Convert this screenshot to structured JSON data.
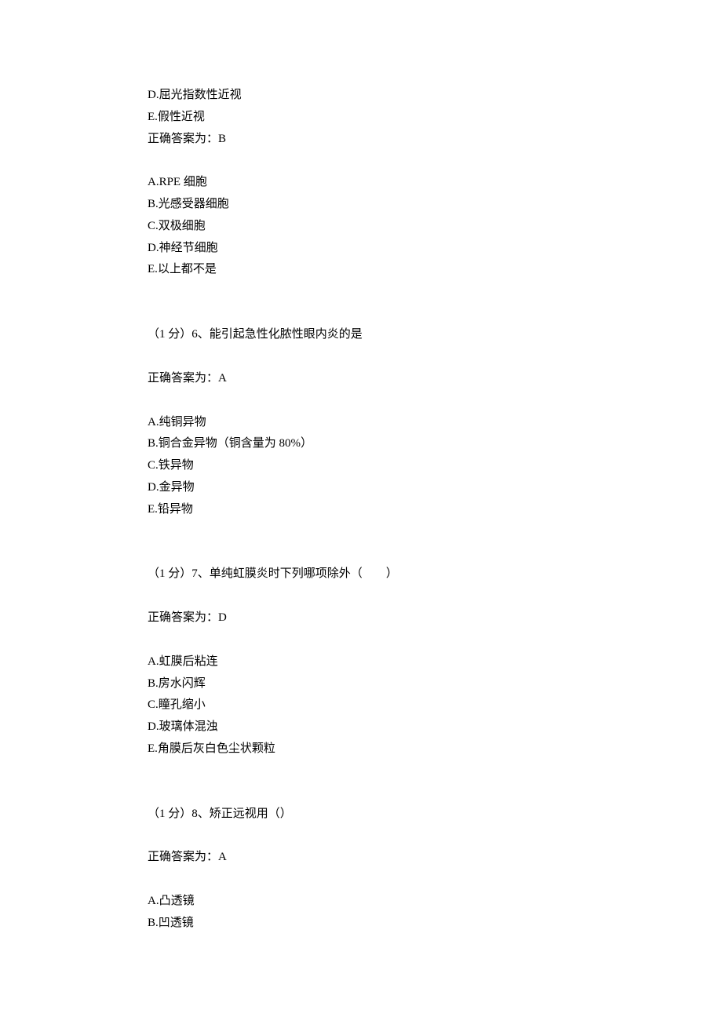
{
  "block1": {
    "lines": [
      "D.屈光指数性近视",
      "E.假性近视",
      "正确答案为：B"
    ]
  },
  "block2": {
    "lines": [
      "A.RPE 细胞",
      "B.光感受器细胞",
      "C.双极细胞",
      "D.神经节细胞",
      "E.以上都不是"
    ]
  },
  "q6": {
    "question": "（1 分）6、能引起急性化脓性眼内炎的是",
    "answer": "正确答案为：A",
    "options": [
      "A.纯铜异物",
      "B.铜合金异物（铜含量为 80%）",
      "C.铁异物",
      "D.金异物",
      "E.铅异物"
    ]
  },
  "q7": {
    "question": "（1 分）7、单纯虹膜炎时下列哪项除外（　　）",
    "answer": "正确答案为：D",
    "options": [
      "A.虹膜后粘连",
      "B.房水闪辉",
      "C.瞳孔缩小",
      "D.玻璃体混浊",
      "E.角膜后灰白色尘状颗粒"
    ]
  },
  "q8": {
    "question": "（1 分）8、矫正远视用（）",
    "answer": "正确答案为：A",
    "options": [
      "A.凸透镜",
      "B.凹透镜"
    ]
  }
}
